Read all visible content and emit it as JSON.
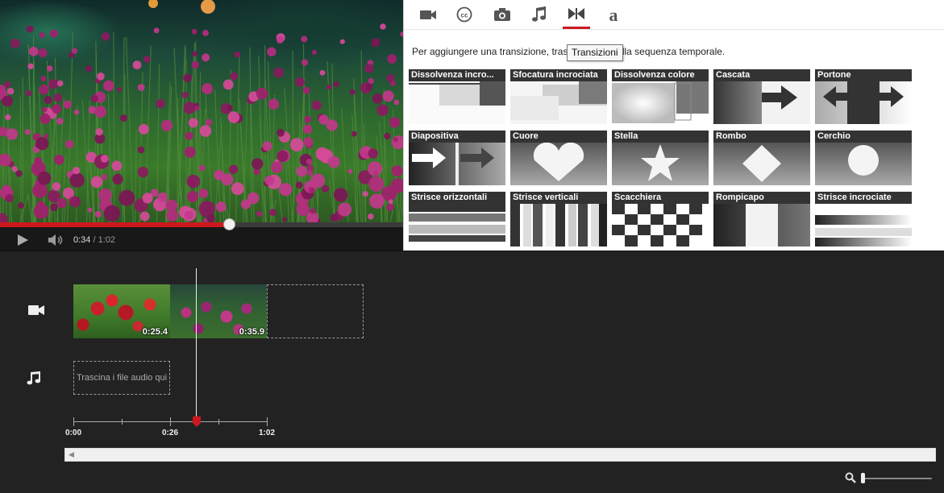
{
  "preview": {
    "current_time": "0:34",
    "separator": " / ",
    "total_time": "1:02",
    "progress_fraction": 0.567
  },
  "tabs": [
    {
      "name": "video-tab",
      "icon": "video-camera-icon"
    },
    {
      "name": "captions-tab",
      "icon": "cc-icon"
    },
    {
      "name": "photos-tab",
      "icon": "camera-icon"
    },
    {
      "name": "audio-tab",
      "icon": "music-note-icon"
    },
    {
      "name": "transitions-tab",
      "icon": "bowtie-icon",
      "active": true
    },
    {
      "name": "text-tab",
      "icon": "letter-a-icon"
    }
  ],
  "tooltip": "Transizioni",
  "instructions": "Per aggiungere una transizione, trascinala qui nella sequenza temporale.",
  "transitions": [
    {
      "label": "Dissolvenza incro...",
      "style": "crossfade"
    },
    {
      "label": "Sfocatura incrociata",
      "style": "blur"
    },
    {
      "label": "Dissolvenza colore",
      "style": "colorfade"
    },
    {
      "label": "Cascata",
      "style": "cascade"
    },
    {
      "label": "Portone",
      "style": "doors"
    },
    {
      "label": "Diapositiva",
      "style": "slide"
    },
    {
      "label": "Cuore",
      "style": "heart"
    },
    {
      "label": "Stella",
      "style": "star"
    },
    {
      "label": "Rombo",
      "style": "diamond"
    },
    {
      "label": "Cerchio",
      "style": "circle"
    },
    {
      "label": "Strisce orizzontali",
      "style": "hstripes"
    },
    {
      "label": "Strisce verticali",
      "style": "vstripes"
    },
    {
      "label": "Scacchiera",
      "style": "checker"
    },
    {
      "label": "Rompicapo",
      "style": "puzzle"
    },
    {
      "label": "Strisce incrociate",
      "style": "crossstripes"
    }
  ],
  "timeline": {
    "clips": [
      {
        "duration": "0:25.4"
      },
      {
        "duration": "0:35.9"
      }
    ],
    "audio_drop_label": "Trascina i file audio qui",
    "ruler_labels": [
      "0:00",
      "0:26",
      "1:02"
    ],
    "zoom_level": 0.0
  },
  "colors": {
    "accent": "#cc181e",
    "panel_bg": "#ffffff",
    "timeline_bg": "#222222"
  }
}
